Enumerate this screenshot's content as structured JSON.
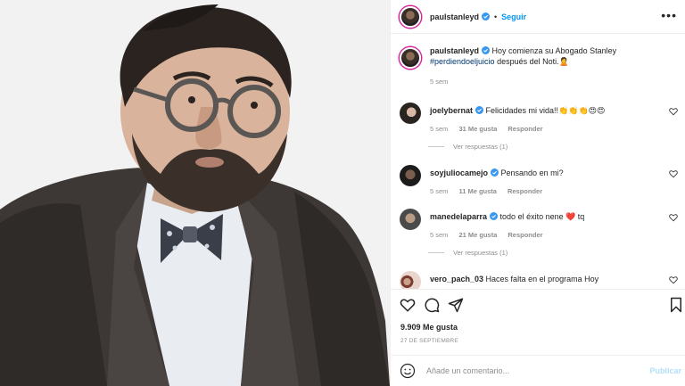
{
  "post": {
    "author": {
      "username": "paulstanleyd",
      "verified": true
    },
    "follow_label": "Seguir",
    "more_icon": "more-options-icon"
  },
  "caption": {
    "username": "paulstanleyd",
    "text_before": " Hoy comienza su Abogado Stanley ",
    "hashtag": "#perdiendoeljuicio",
    "text_after": " después del Noti.🙎",
    "time": "5 sem"
  },
  "comments": [
    {
      "username": "joelybernat",
      "verified": true,
      "text": " Felicidades mi vida!!👏👏👏😍😍",
      "time": "5 sem",
      "likes": "31 Me gusta",
      "reply": "Responder",
      "replies": "Ver respuestas (1)"
    },
    {
      "username": "soyjuliocamejo",
      "verified": true,
      "text": " Pensando en mi?",
      "time": "5 sem",
      "likes": "11 Me gusta",
      "reply": "Responder",
      "replies": ""
    },
    {
      "username": "manedelaparra",
      "verified": true,
      "text": " todo el éxito nene ❤️ tq",
      "time": "5 sem",
      "likes": "21 Me gusta",
      "reply": "Responder",
      "replies": "Ver respuestas (1)"
    },
    {
      "username": "vero_pach_03",
      "verified": false,
      "text": " Haces falta en el programa Hoy",
      "time": "",
      "likes": "",
      "reply": "",
      "replies": ""
    }
  ],
  "actions": {
    "like_icon": "heart-icon",
    "comment_icon": "comment-icon",
    "share_icon": "share-icon",
    "save_icon": "bookmark-icon"
  },
  "likes_count": "9.909 Me gusta",
  "date": "27 DE SEPTIEMBRE",
  "add_comment": {
    "emoji_icon": "emoji-icon",
    "placeholder": "Añade un comentario...",
    "publish_label": "Publicar"
  },
  "colors": {
    "link": "#0095f6",
    "hashtag": "#00376b",
    "heart": "#ed4956",
    "muted": "#8e8e8e"
  }
}
